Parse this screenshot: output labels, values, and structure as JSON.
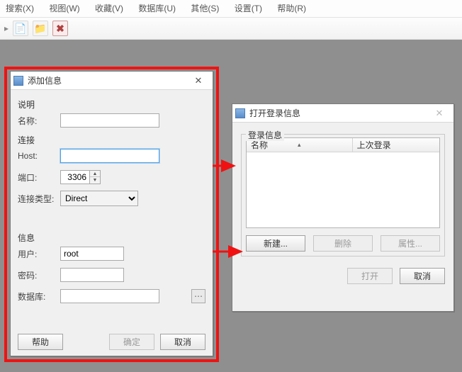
{
  "menu": {
    "search": "搜索(X)",
    "view": "视图(W)",
    "fav": "收藏(V)",
    "db": "数据库(U)",
    "other": "其他(S)",
    "setting": "设置(T)",
    "help": "帮助(R)"
  },
  "add_dialog": {
    "title": "添加信息",
    "sections": {
      "desc": "说明",
      "conn": "连接",
      "info": "信息"
    },
    "labels": {
      "name": "名称:",
      "host": "Host:",
      "port": "端口:",
      "conn_type": "连接类型:",
      "user": "用户:",
      "password": "密码:",
      "database": "数据库:"
    },
    "values": {
      "name": "",
      "host": "",
      "port": "3306",
      "conn_type": "Direct",
      "user": "root",
      "password": "",
      "database": ""
    },
    "buttons": {
      "help": "帮助",
      "ok": "确定",
      "cancel": "取消"
    }
  },
  "open_dialog": {
    "title": "打开登录信息",
    "group": "登录信息",
    "columns": {
      "name": "名称",
      "last_login": "上次登录"
    },
    "buttons": {
      "new": "新建...",
      "delete": "删除",
      "props": "属性...",
      "open": "打开",
      "cancel": "取消"
    }
  }
}
